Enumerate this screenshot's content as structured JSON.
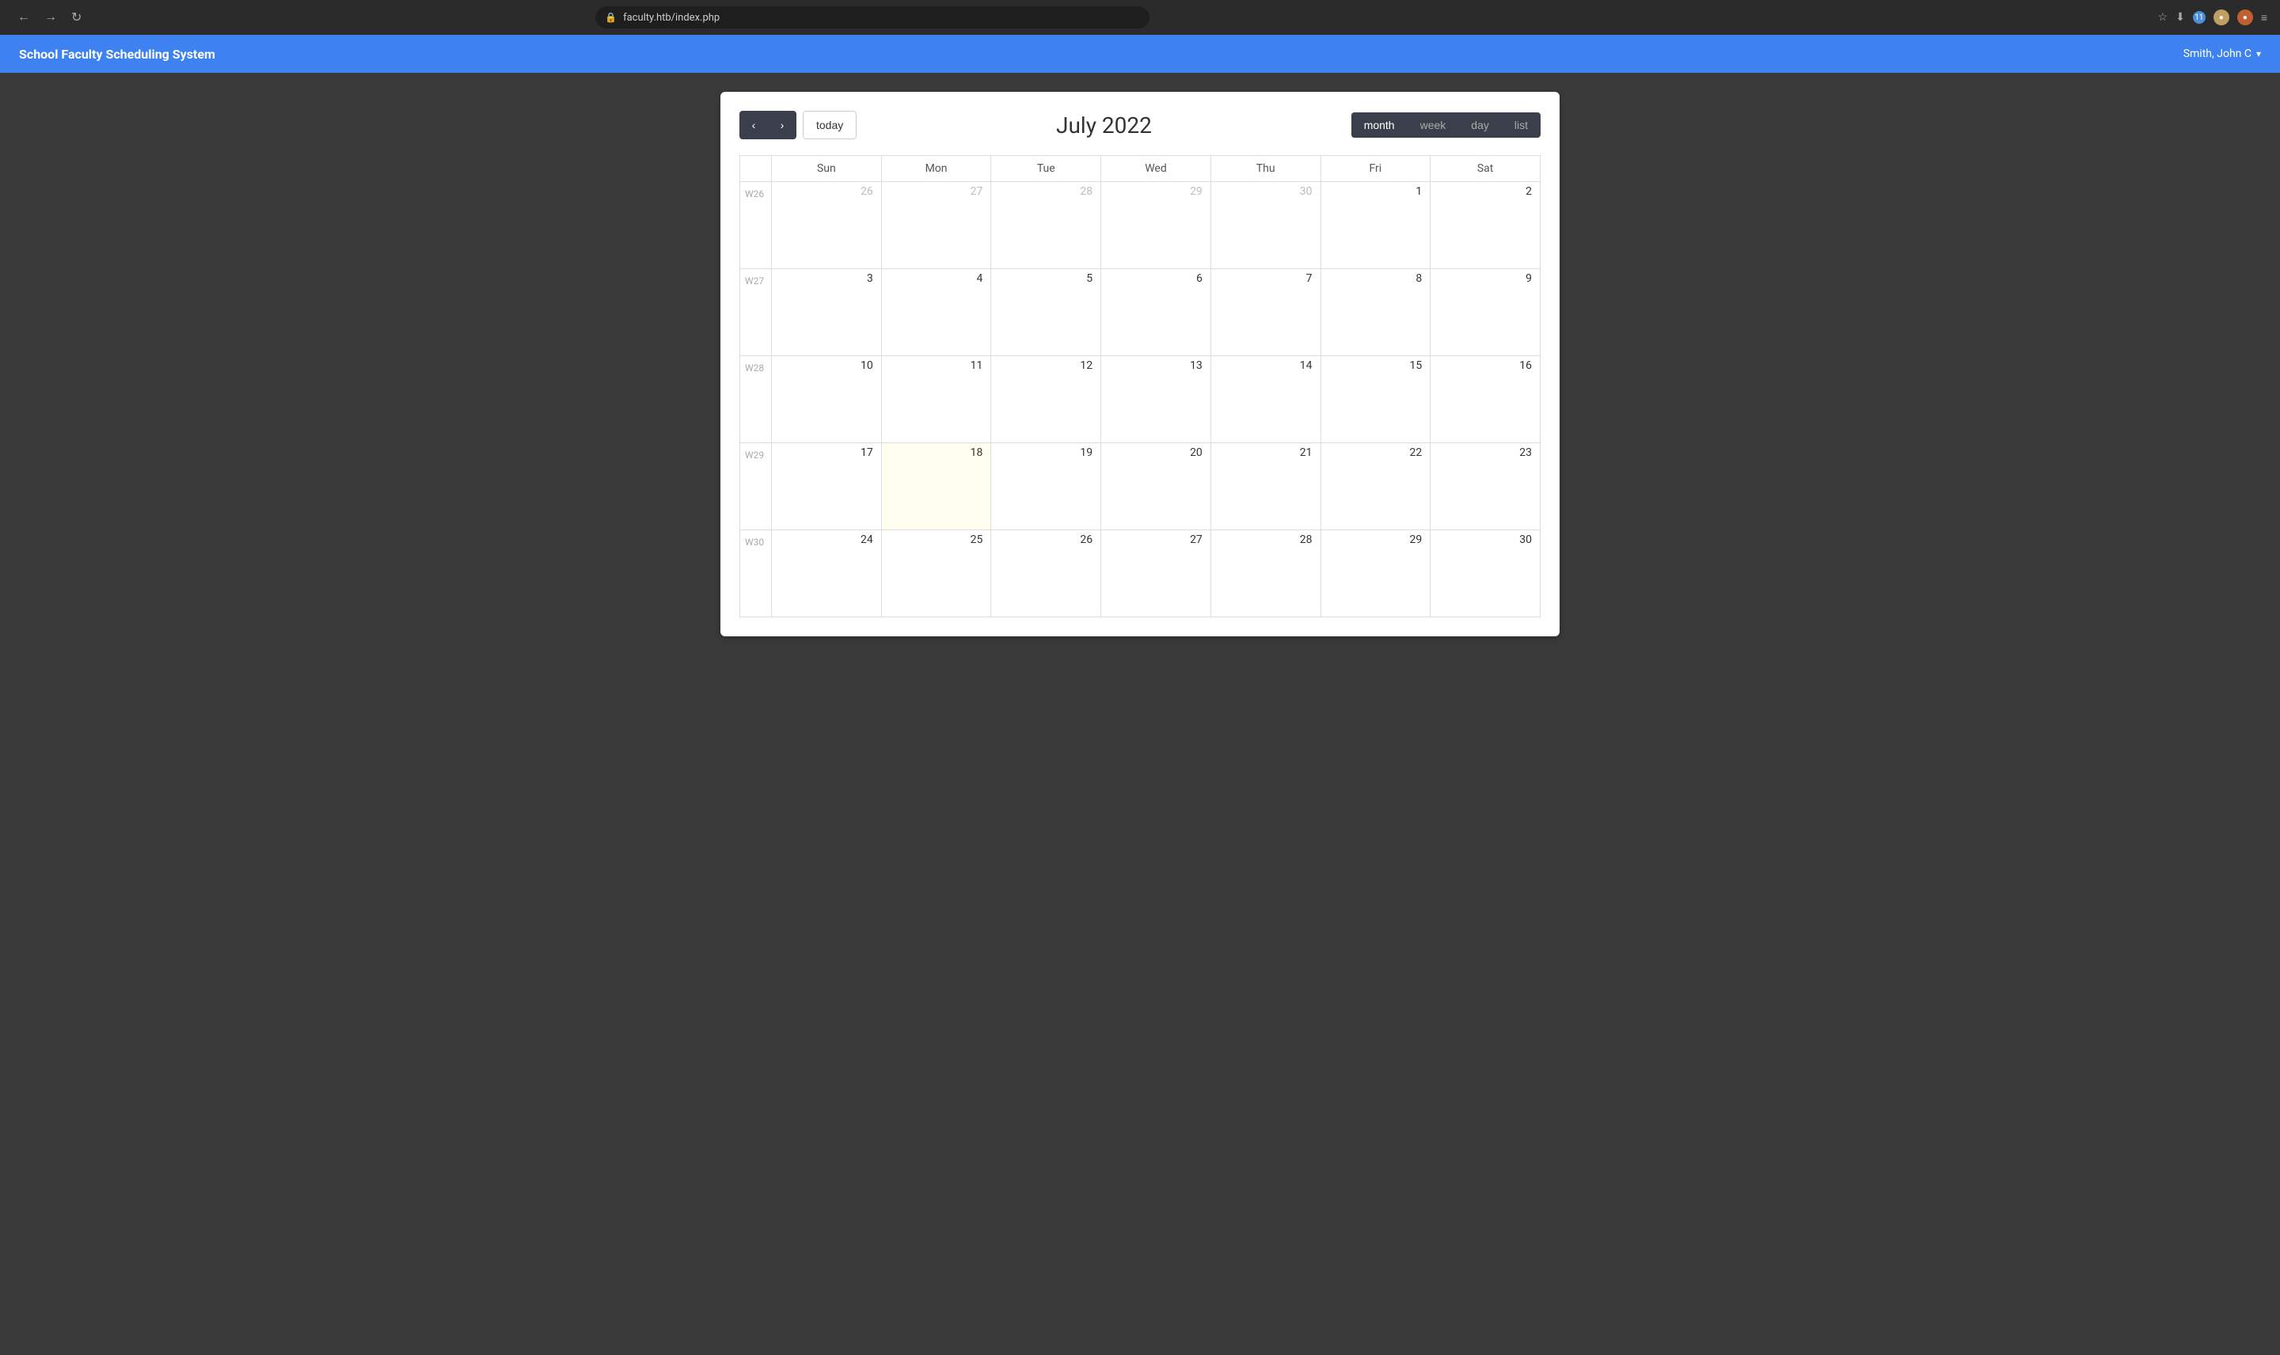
{
  "browser": {
    "url": "faculty.htb/index.php",
    "back_label": "←",
    "forward_label": "→",
    "refresh_label": "↻",
    "star_icon": "☆",
    "badge_count": "11",
    "menu_icon": "≡"
  },
  "app": {
    "title": "School Faculty Scheduling System",
    "user": "Smith, John C",
    "dropdown_arrow": "▾"
  },
  "calendar": {
    "title": "July 2022",
    "today_label": "today",
    "prev_label": "‹",
    "next_label": "›",
    "view_buttons": [
      "month",
      "week",
      "day",
      "list"
    ],
    "active_view": "month",
    "days_of_week": [
      "Sun",
      "Mon",
      "Tue",
      "Wed",
      "Thu",
      "Fri",
      "Sat"
    ],
    "weeks": [
      {
        "week_num": "W26",
        "days": [
          {
            "num": "26",
            "muted": true,
            "today": false
          },
          {
            "num": "27",
            "muted": true,
            "today": false
          },
          {
            "num": "28",
            "muted": true,
            "today": false
          },
          {
            "num": "29",
            "muted": true,
            "today": false
          },
          {
            "num": "30",
            "muted": true,
            "today": false
          },
          {
            "num": "1",
            "muted": false,
            "today": false
          },
          {
            "num": "2",
            "muted": false,
            "today": false
          }
        ]
      },
      {
        "week_num": "W27",
        "days": [
          {
            "num": "3",
            "muted": false,
            "today": false
          },
          {
            "num": "4",
            "muted": false,
            "today": false
          },
          {
            "num": "5",
            "muted": false,
            "today": false
          },
          {
            "num": "6",
            "muted": false,
            "today": false
          },
          {
            "num": "7",
            "muted": false,
            "today": false
          },
          {
            "num": "8",
            "muted": false,
            "today": false
          },
          {
            "num": "9",
            "muted": false,
            "today": false
          }
        ]
      },
      {
        "week_num": "W28",
        "days": [
          {
            "num": "10",
            "muted": false,
            "today": false
          },
          {
            "num": "11",
            "muted": false,
            "today": false
          },
          {
            "num": "12",
            "muted": false,
            "today": false
          },
          {
            "num": "13",
            "muted": false,
            "today": false
          },
          {
            "num": "14",
            "muted": false,
            "today": false
          },
          {
            "num": "15",
            "muted": false,
            "today": false
          },
          {
            "num": "16",
            "muted": false,
            "today": false
          }
        ]
      },
      {
        "week_num": "W29",
        "days": [
          {
            "num": "17",
            "muted": false,
            "today": false
          },
          {
            "num": "18",
            "muted": false,
            "today": true
          },
          {
            "num": "19",
            "muted": false,
            "today": false
          },
          {
            "num": "20",
            "muted": false,
            "today": false
          },
          {
            "num": "21",
            "muted": false,
            "today": false
          },
          {
            "num": "22",
            "muted": false,
            "today": false
          },
          {
            "num": "23",
            "muted": false,
            "today": false
          }
        ]
      },
      {
        "week_num": "W30",
        "days": [
          {
            "num": "24",
            "muted": false,
            "today": false
          },
          {
            "num": "25",
            "muted": false,
            "today": false
          },
          {
            "num": "26",
            "muted": false,
            "today": false
          },
          {
            "num": "27",
            "muted": false,
            "today": false
          },
          {
            "num": "28",
            "muted": false,
            "today": false
          },
          {
            "num": "29",
            "muted": false,
            "today": false
          },
          {
            "num": "30",
            "muted": false,
            "today": false
          }
        ]
      }
    ]
  }
}
